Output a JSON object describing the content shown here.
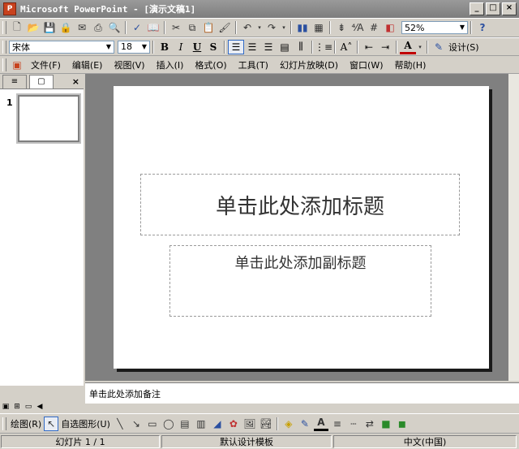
{
  "window": {
    "title": "Microsoft PowerPoint - [演示文稿1]",
    "app_icon_letter": "P",
    "min_label": "_",
    "max_label": "□",
    "close_label": "×"
  },
  "standard_toolbar": {
    "zoom_value": "52%",
    "icons": [
      "new-icon",
      "open-icon",
      "save-icon",
      "permission-icon",
      "email-icon",
      "print-icon",
      "print-preview-icon",
      "spelling-icon",
      "research-icon",
      "cut-icon",
      "copy-icon",
      "paste-icon",
      "format-painter-icon",
      "undo-icon",
      "redo-icon",
      "insert-chart-icon",
      "insert-table-icon",
      "expand-all-icon",
      "show-formatting-icon",
      "show-grid-icon",
      "color-grayscale-icon"
    ],
    "help_icon": "?"
  },
  "format_toolbar": {
    "font_name": "宋体",
    "font_size": "18",
    "bold": "B",
    "italic": "I",
    "underline": "U",
    "shadow": "S",
    "font_color_label": "A",
    "design_label": "设计(S)"
  },
  "menu": {
    "items": [
      "文件(F)",
      "编辑(E)",
      "视图(V)",
      "插入(I)",
      "格式(O)",
      "工具(T)",
      "幻灯片放映(D)",
      "窗口(W)",
      "帮助(H)"
    ]
  },
  "left_pane": {
    "tab_outline": "≡",
    "tab_slides": "▢",
    "close": "×",
    "slide_number": "1"
  },
  "slide": {
    "title_placeholder": "单击此处添加标题",
    "subtitle_placeholder": "单击此处添加副标题"
  },
  "notes": {
    "placeholder": "单击此处添加备注"
  },
  "drawing_toolbar": {
    "draw_label": "绘图(R)",
    "autoshapes_label": "自选图形(U)"
  },
  "status": {
    "slide_info": "幻灯片 1 / 1",
    "template": "默认设计模板",
    "language": "中文(中国)"
  },
  "colors": {
    "titlebar": "#8a8a8a",
    "workspace": "#808080",
    "chrome": "#d4d0c8"
  }
}
